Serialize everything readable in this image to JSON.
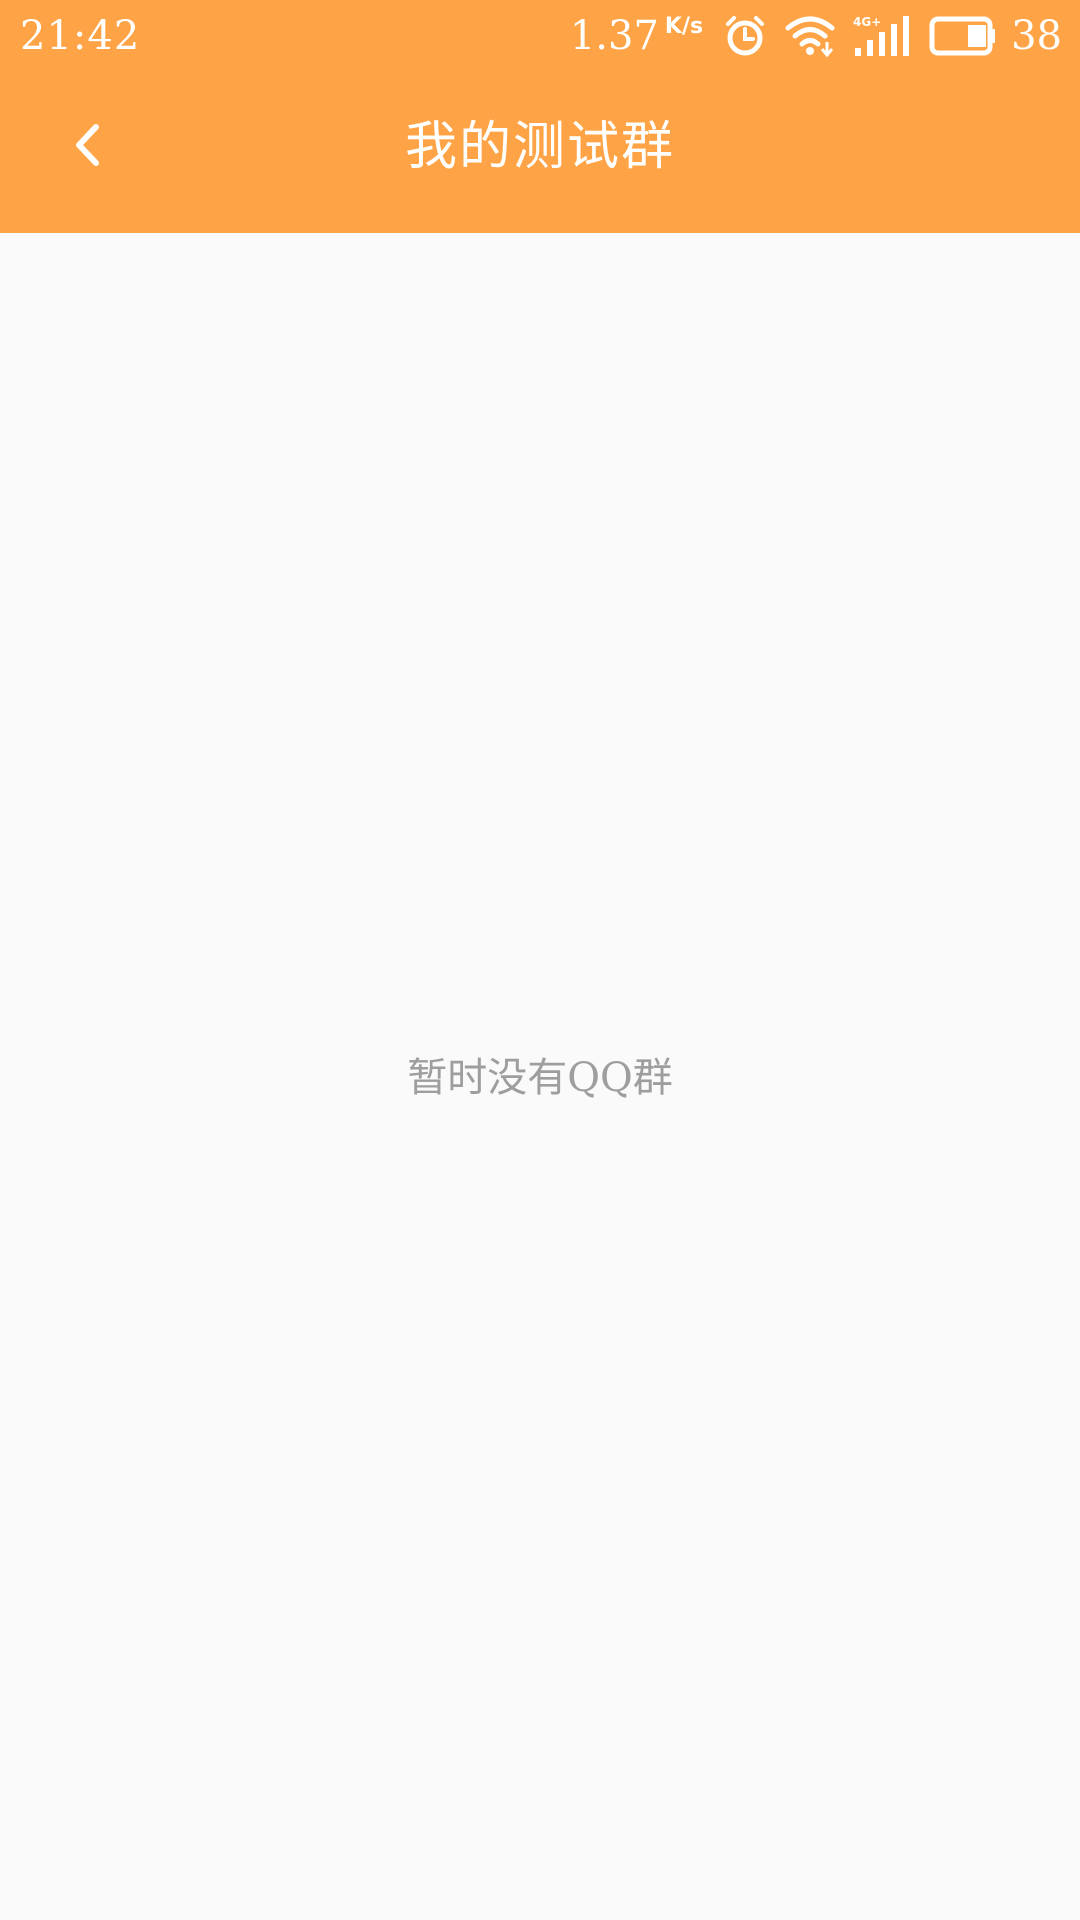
{
  "status_bar": {
    "time": "21:42",
    "network_speed": "1.37",
    "network_speed_unit": "K/s",
    "network_type": "4G+",
    "battery_level": "38",
    "battery_fraction": 0.38,
    "icons": [
      "alarm-icon",
      "wifi-icon",
      "signal-icon",
      "battery-icon"
    ]
  },
  "app_bar": {
    "back_icon": "chevron-left-icon",
    "title": "我的测试群"
  },
  "content": {
    "empty_message": "暂时没有QQ群"
  },
  "colors": {
    "accent": "#ffa446",
    "background": "#fafafa",
    "empty_text": "#9e9e9e",
    "on_accent": "#ffffff"
  }
}
